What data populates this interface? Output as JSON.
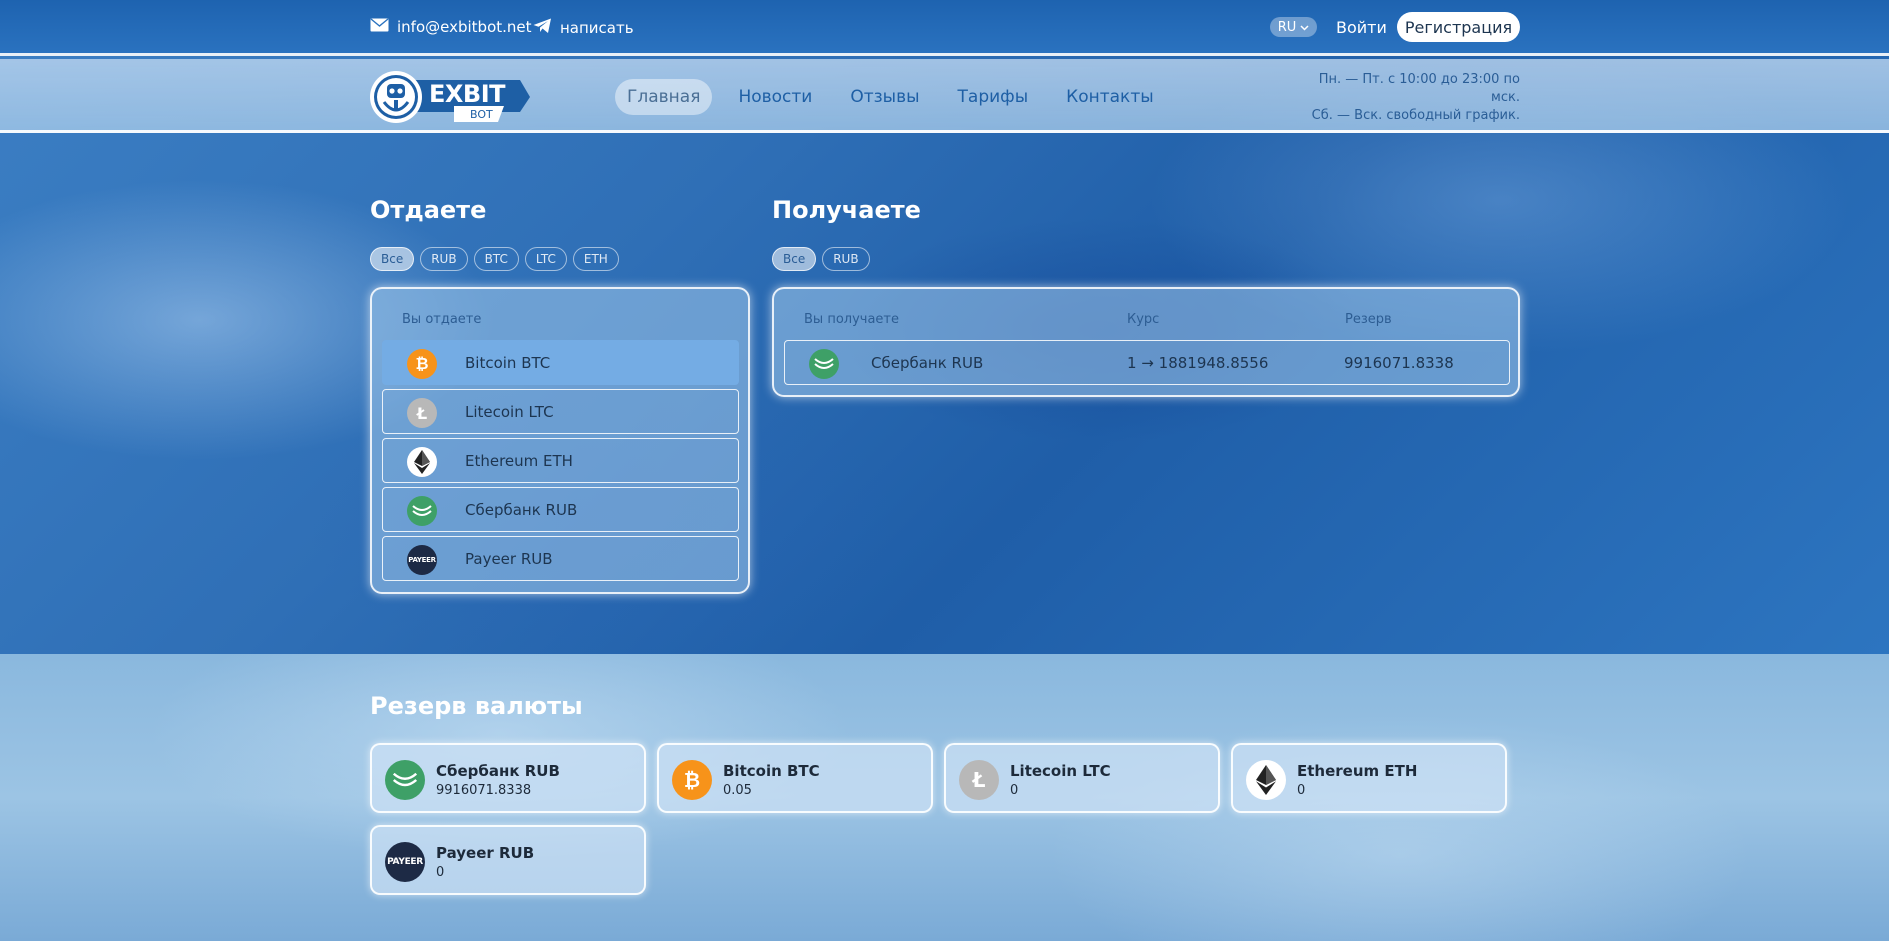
{
  "topbar": {
    "email": "info@exbitbot.net",
    "telegram_label": "написать",
    "language": "RU",
    "login_label": "Войти",
    "register_label": "Регистрация"
  },
  "brand": {
    "logo_word": "EXBIT",
    "logo_sub": "BOT"
  },
  "nav": {
    "items": [
      {
        "label": "Главная",
        "active": true
      },
      {
        "label": "Новости"
      },
      {
        "label": "Отзывы"
      },
      {
        "label": "Тарифы"
      },
      {
        "label": "Контакты"
      }
    ]
  },
  "hours": {
    "line1": "Пн. — Пт. с 10:00 до 23:00 по",
    "line2": "мск.",
    "line3": "Сб. — Вск. свободный график."
  },
  "give": {
    "title": "Отдаете",
    "filters": [
      "Все",
      "RUB",
      "BTC",
      "LTC",
      "ETH"
    ],
    "column_label": "Вы отдаете",
    "items": [
      {
        "icon": "bitcoin-icon",
        "label": "Bitcoin BTC",
        "selected": true
      },
      {
        "icon": "litecoin-icon",
        "label": "Litecoin LTC"
      },
      {
        "icon": "ethereum-icon",
        "label": "Ethereum ETH"
      },
      {
        "icon": "sberbank-icon",
        "label": "Сбербанк RUB"
      },
      {
        "icon": "payeer-icon",
        "label": "Payeer RUB"
      }
    ]
  },
  "receive": {
    "title": "Получаете",
    "filters": [
      "Все",
      "RUB"
    ],
    "columns": {
      "name": "Вы получаете",
      "rate": "Курс",
      "reserve": "Резерв"
    },
    "items": [
      {
        "icon": "sberbank-icon",
        "label": "Сбербанк RUB",
        "rate": "1 → 1881948.8556",
        "reserve": "9916071.8338"
      }
    ]
  },
  "reserve": {
    "title": "Резерв валюты",
    "cards": [
      {
        "icon": "sberbank-icon",
        "name": "Сбербанк RUB",
        "amount": "9916071.8338"
      },
      {
        "icon": "bitcoin-icon",
        "name": "Bitcoin BTC",
        "amount": "0.05"
      },
      {
        "icon": "litecoin-icon",
        "name": "Litecoin LTC",
        "amount": "0"
      },
      {
        "icon": "ethereum-icon",
        "name": "Ethereum ETH",
        "amount": "0"
      },
      {
        "icon": "payeer-icon",
        "name": "Payeer RUB",
        "amount": "0"
      }
    ]
  },
  "icon_text": {
    "bitcoin": "₿",
    "litecoin": "Ł",
    "payeer": "PAYEER"
  },
  "colors": {
    "accent": "#2a72bf",
    "selected_row": "#74ace4",
    "bitcoin": "#f7931a",
    "sberbank": "#3ea067"
  }
}
